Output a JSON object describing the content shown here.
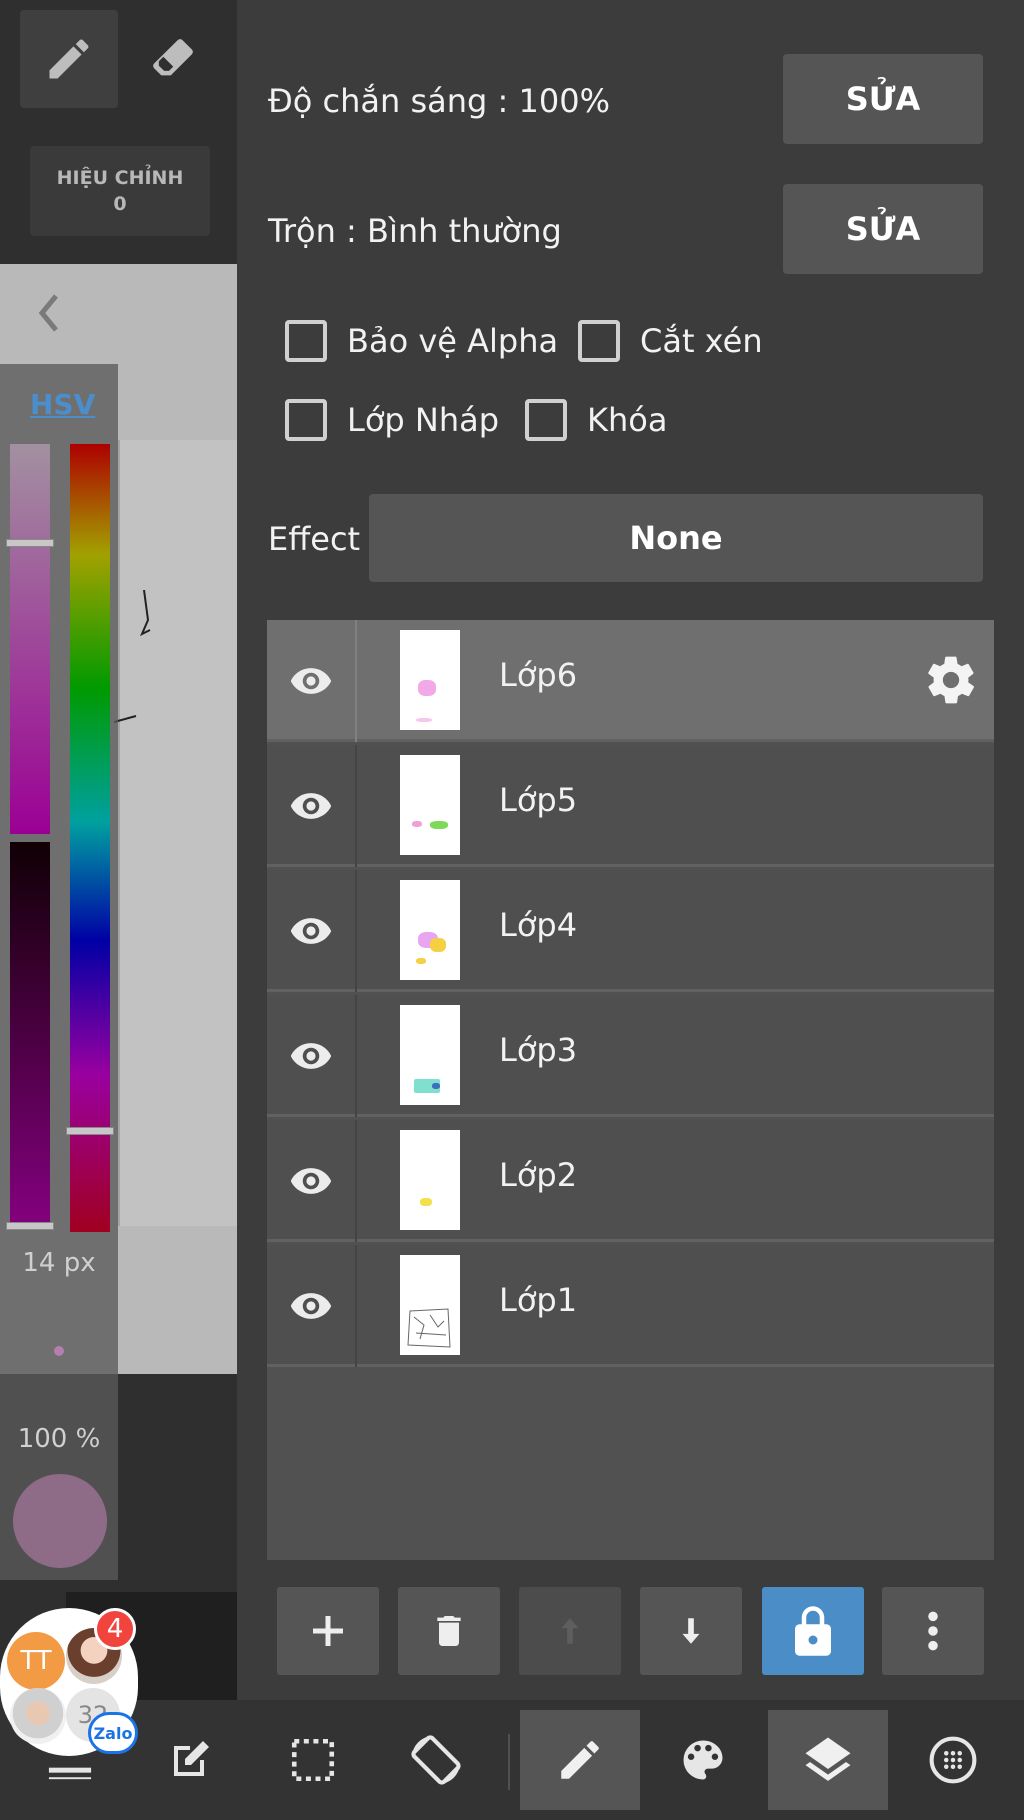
{
  "left_panel": {
    "adjust": {
      "label": "HIỆU CHỈNH",
      "value": "0"
    },
    "color_mode": "HSV",
    "brush_size": "14 px",
    "brush_opacity": "100 %",
    "current_color": "#8e6b87"
  },
  "layer_settings": {
    "opacity_label": "Độ chắn sáng : 100%",
    "opacity_edit": "SỬA",
    "blend_label": "Trộn : Bình thường",
    "blend_edit": "SỬA",
    "protect_alpha": "Bảo vệ Alpha",
    "clipping": "Cắt xén",
    "draft_layer": "Lớp Nháp",
    "lock": "Khóa",
    "effect_label": "Effect",
    "effect_value": "None"
  },
  "layers": [
    {
      "name": "Lớp6",
      "selected": true
    },
    {
      "name": "Lớp5",
      "selected": false
    },
    {
      "name": "Lớp4",
      "selected": false
    },
    {
      "name": "Lớp3",
      "selected": false
    },
    {
      "name": "Lớp2",
      "selected": false
    },
    {
      "name": "Lớp1",
      "selected": false
    }
  ],
  "chat_head": {
    "initials": "TT",
    "unread_count": "4",
    "member_count": "32",
    "app": "Zalo"
  },
  "colors": {
    "accent": "#4b8ec7",
    "hsv_link": "#4c8ecb"
  }
}
